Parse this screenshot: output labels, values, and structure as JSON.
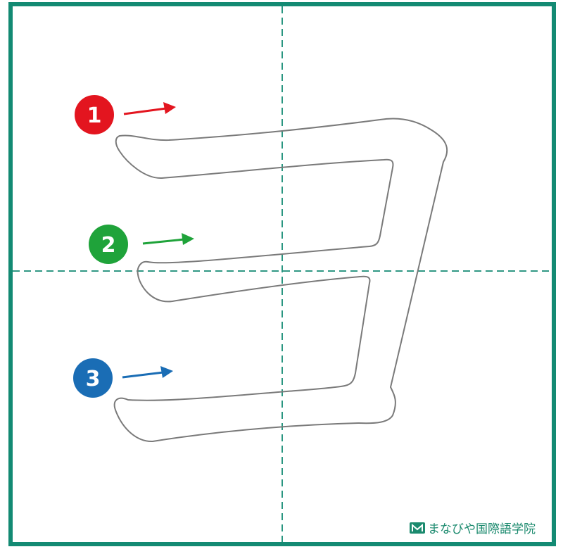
{
  "colors": {
    "frame": "#138a73",
    "guide": "#138a73",
    "outline": "#7a7a7a",
    "stroke_1": "#e3151f",
    "stroke_2": "#1fa33a",
    "stroke_3": "#1a6db5"
  },
  "strokes": [
    {
      "number": "1",
      "color": "#e3151f"
    },
    {
      "number": "2",
      "color": "#1fa33a"
    },
    {
      "number": "3",
      "color": "#1a6db5"
    }
  ],
  "brand": {
    "logo_icon": "open-book-m-icon",
    "name": "まなびや国際語学院"
  }
}
